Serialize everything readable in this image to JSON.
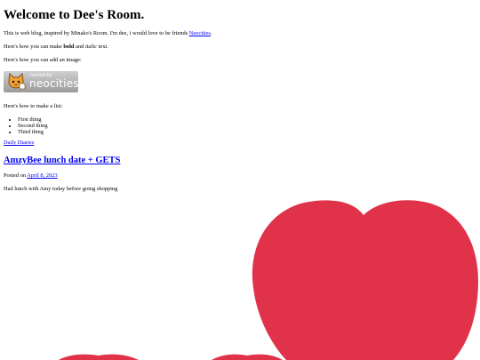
{
  "page": {
    "title": "Welcome to Dee's Room.",
    "intro": {
      "text": "This is web blog, inspired by Minako's Room. I'm dee, i would love to be friends ",
      "link": "Neocities",
      "end": "."
    },
    "bold_line": {
      "prefix": "Here's how you can make ",
      "bold": "bold",
      "middle": " and ",
      "italic": "italic",
      "suffix": " text."
    },
    "image_line": "Here's how you can add an image:",
    "badge": {
      "hosted": "hosted by",
      "neocities": "neocities"
    },
    "list_line": "Here's how to make a list:",
    "list_items": [
      "First thing",
      "Second thing",
      "Third thing"
    ],
    "category_link": "Daily Diaries",
    "post": {
      "title": "AmzyBee lunch date + GETS",
      "posted_prefix": "Posted on ",
      "date": "April 8, 2023",
      "body": "Had lunch with Amy today before going shopping"
    }
  },
  "colors": {
    "heart": "#e0334a",
    "link": "#0000ee"
  }
}
